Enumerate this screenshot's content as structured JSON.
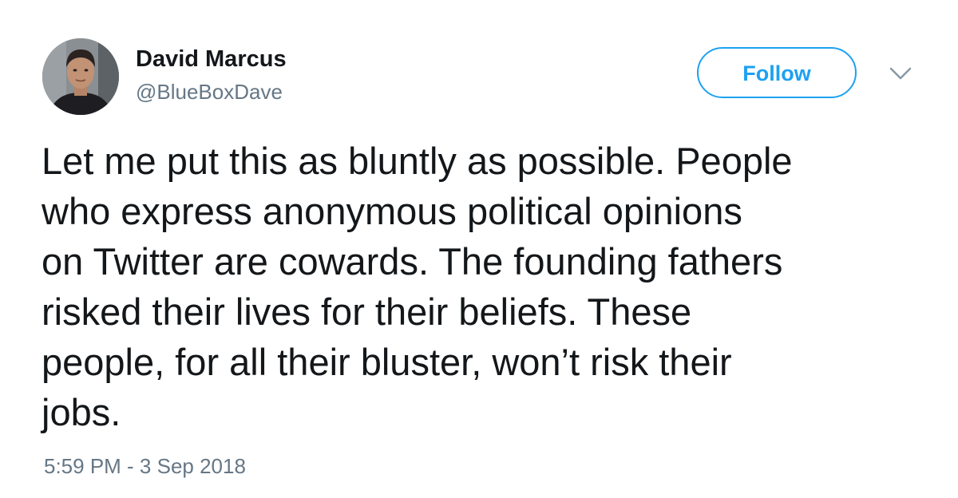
{
  "author": {
    "display_name": "David Marcus",
    "handle": "@BlueBoxDave",
    "avatar": "profile-photo"
  },
  "actions": {
    "follow_label": "Follow",
    "more_icon": "chevron-down-icon"
  },
  "tweet": {
    "lines": [
      "Let me put this as bluntly as possible. People",
      "who express anonymous political opinions",
      "on Twitter are cowards. The founding fathers",
      "risked their lives for their beliefs. These",
      "people, for all their bluster, won’t risk their",
      "jobs."
    ],
    "timestamp": "5:59 PM - 3 Sep 2018"
  },
  "colors": {
    "accent": "#1da1f2",
    "text_primary": "#14171a",
    "text_secondary": "#657786",
    "background": "#ffffff"
  }
}
